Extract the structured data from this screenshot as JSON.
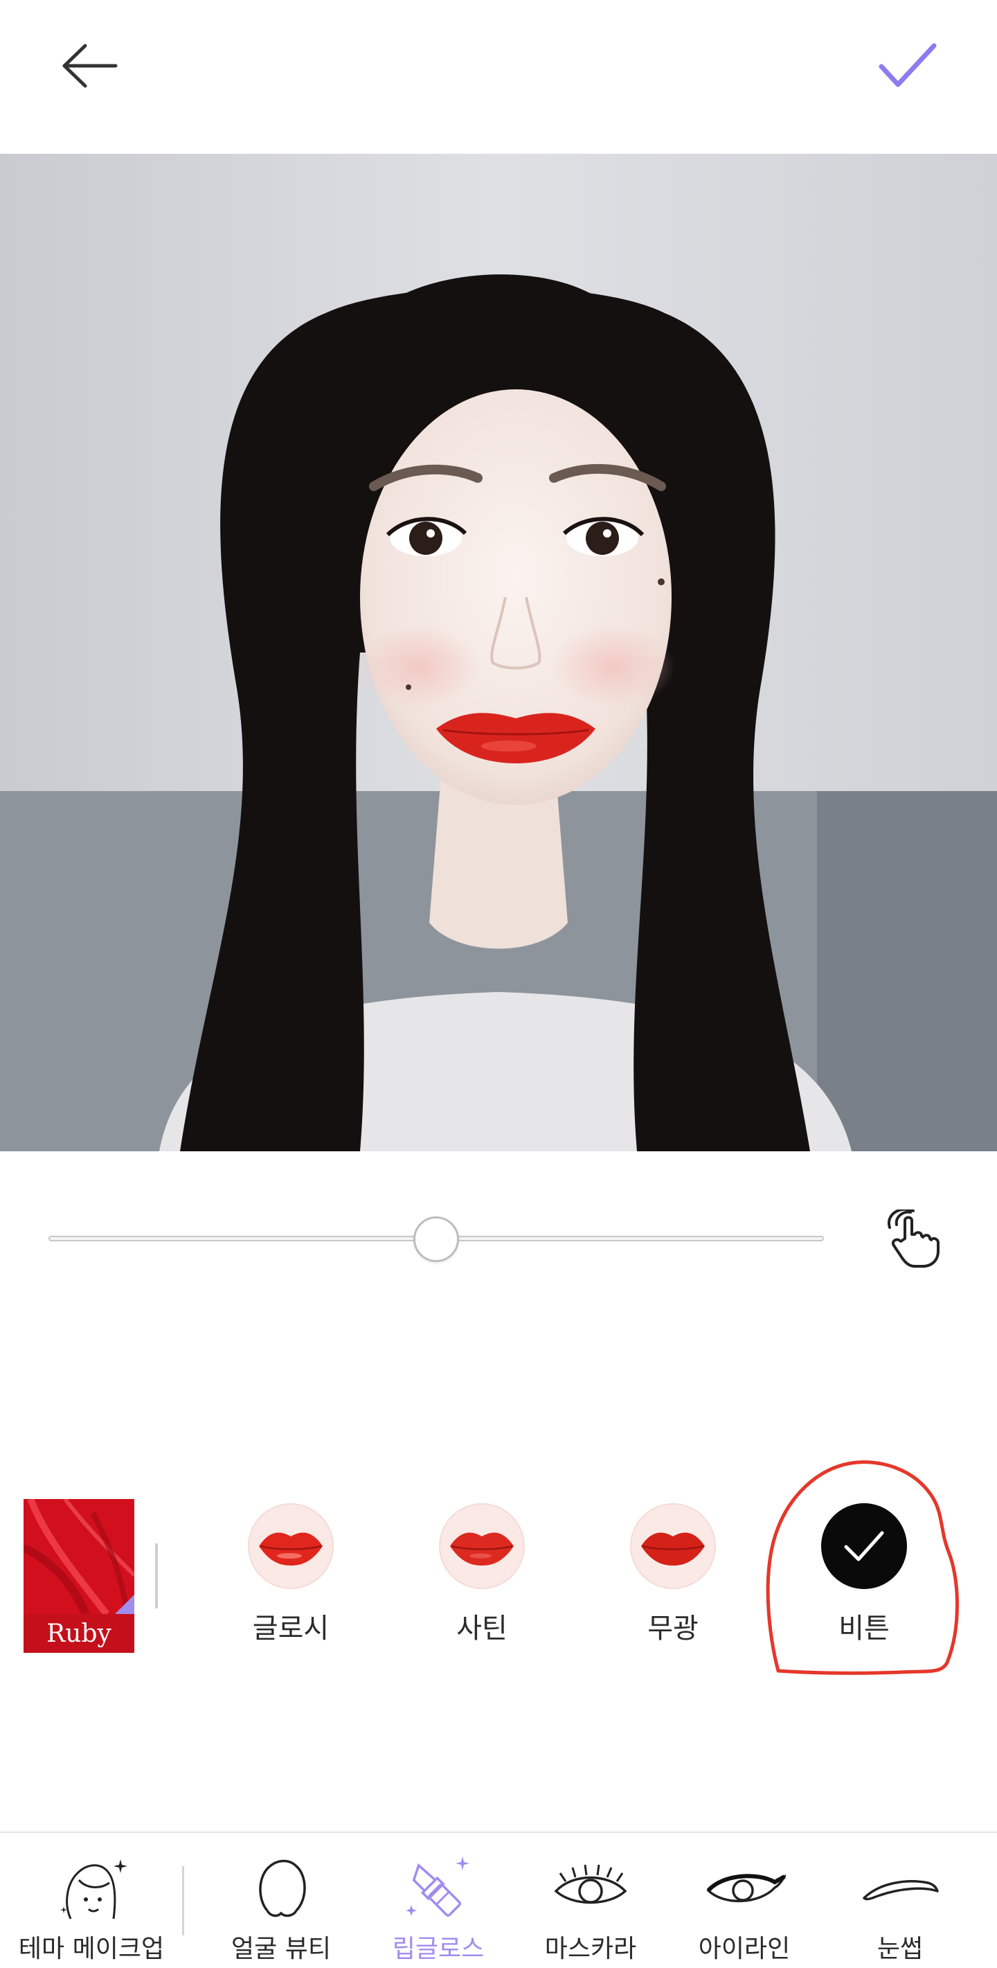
{
  "header": {
    "back_icon": "arrow-left-icon",
    "confirm_icon": "checkmark-icon",
    "accent_color": "#8c7cf0"
  },
  "photo": {
    "subject": "portrait",
    "lip_color": "#d9241e"
  },
  "slider": {
    "value_fraction": 0.5,
    "touch_icon": "hand-touch-icon"
  },
  "color_swatch": {
    "name": "Ruby",
    "color": "#d0101e"
  },
  "finishes": [
    {
      "label": "글로시",
      "icon": "lips-icon",
      "selected": false
    },
    {
      "label": "사틴",
      "icon": "lips-icon",
      "selected": false
    },
    {
      "label": "무광",
      "icon": "lips-icon",
      "selected": false
    },
    {
      "label": "비튼",
      "icon": "checkmark-icon",
      "selected": true
    }
  ],
  "annotation": {
    "color": "#e5372b"
  },
  "bottom_nav": {
    "active_color": "#9f8df0",
    "items": [
      {
        "label": "테마 메이크업",
        "icon": "face-sparkle-icon"
      },
      {
        "label": "얼굴 뷰티",
        "icon": "face-outline-icon"
      },
      {
        "label": "립글로스",
        "icon": "lipstick-icon",
        "active": true
      },
      {
        "label": "마스카라",
        "icon": "eyelash-icon"
      },
      {
        "label": "아이라인",
        "icon": "eyeliner-icon"
      },
      {
        "label": "눈썹",
        "icon": "eyebrow-icon"
      }
    ]
  }
}
